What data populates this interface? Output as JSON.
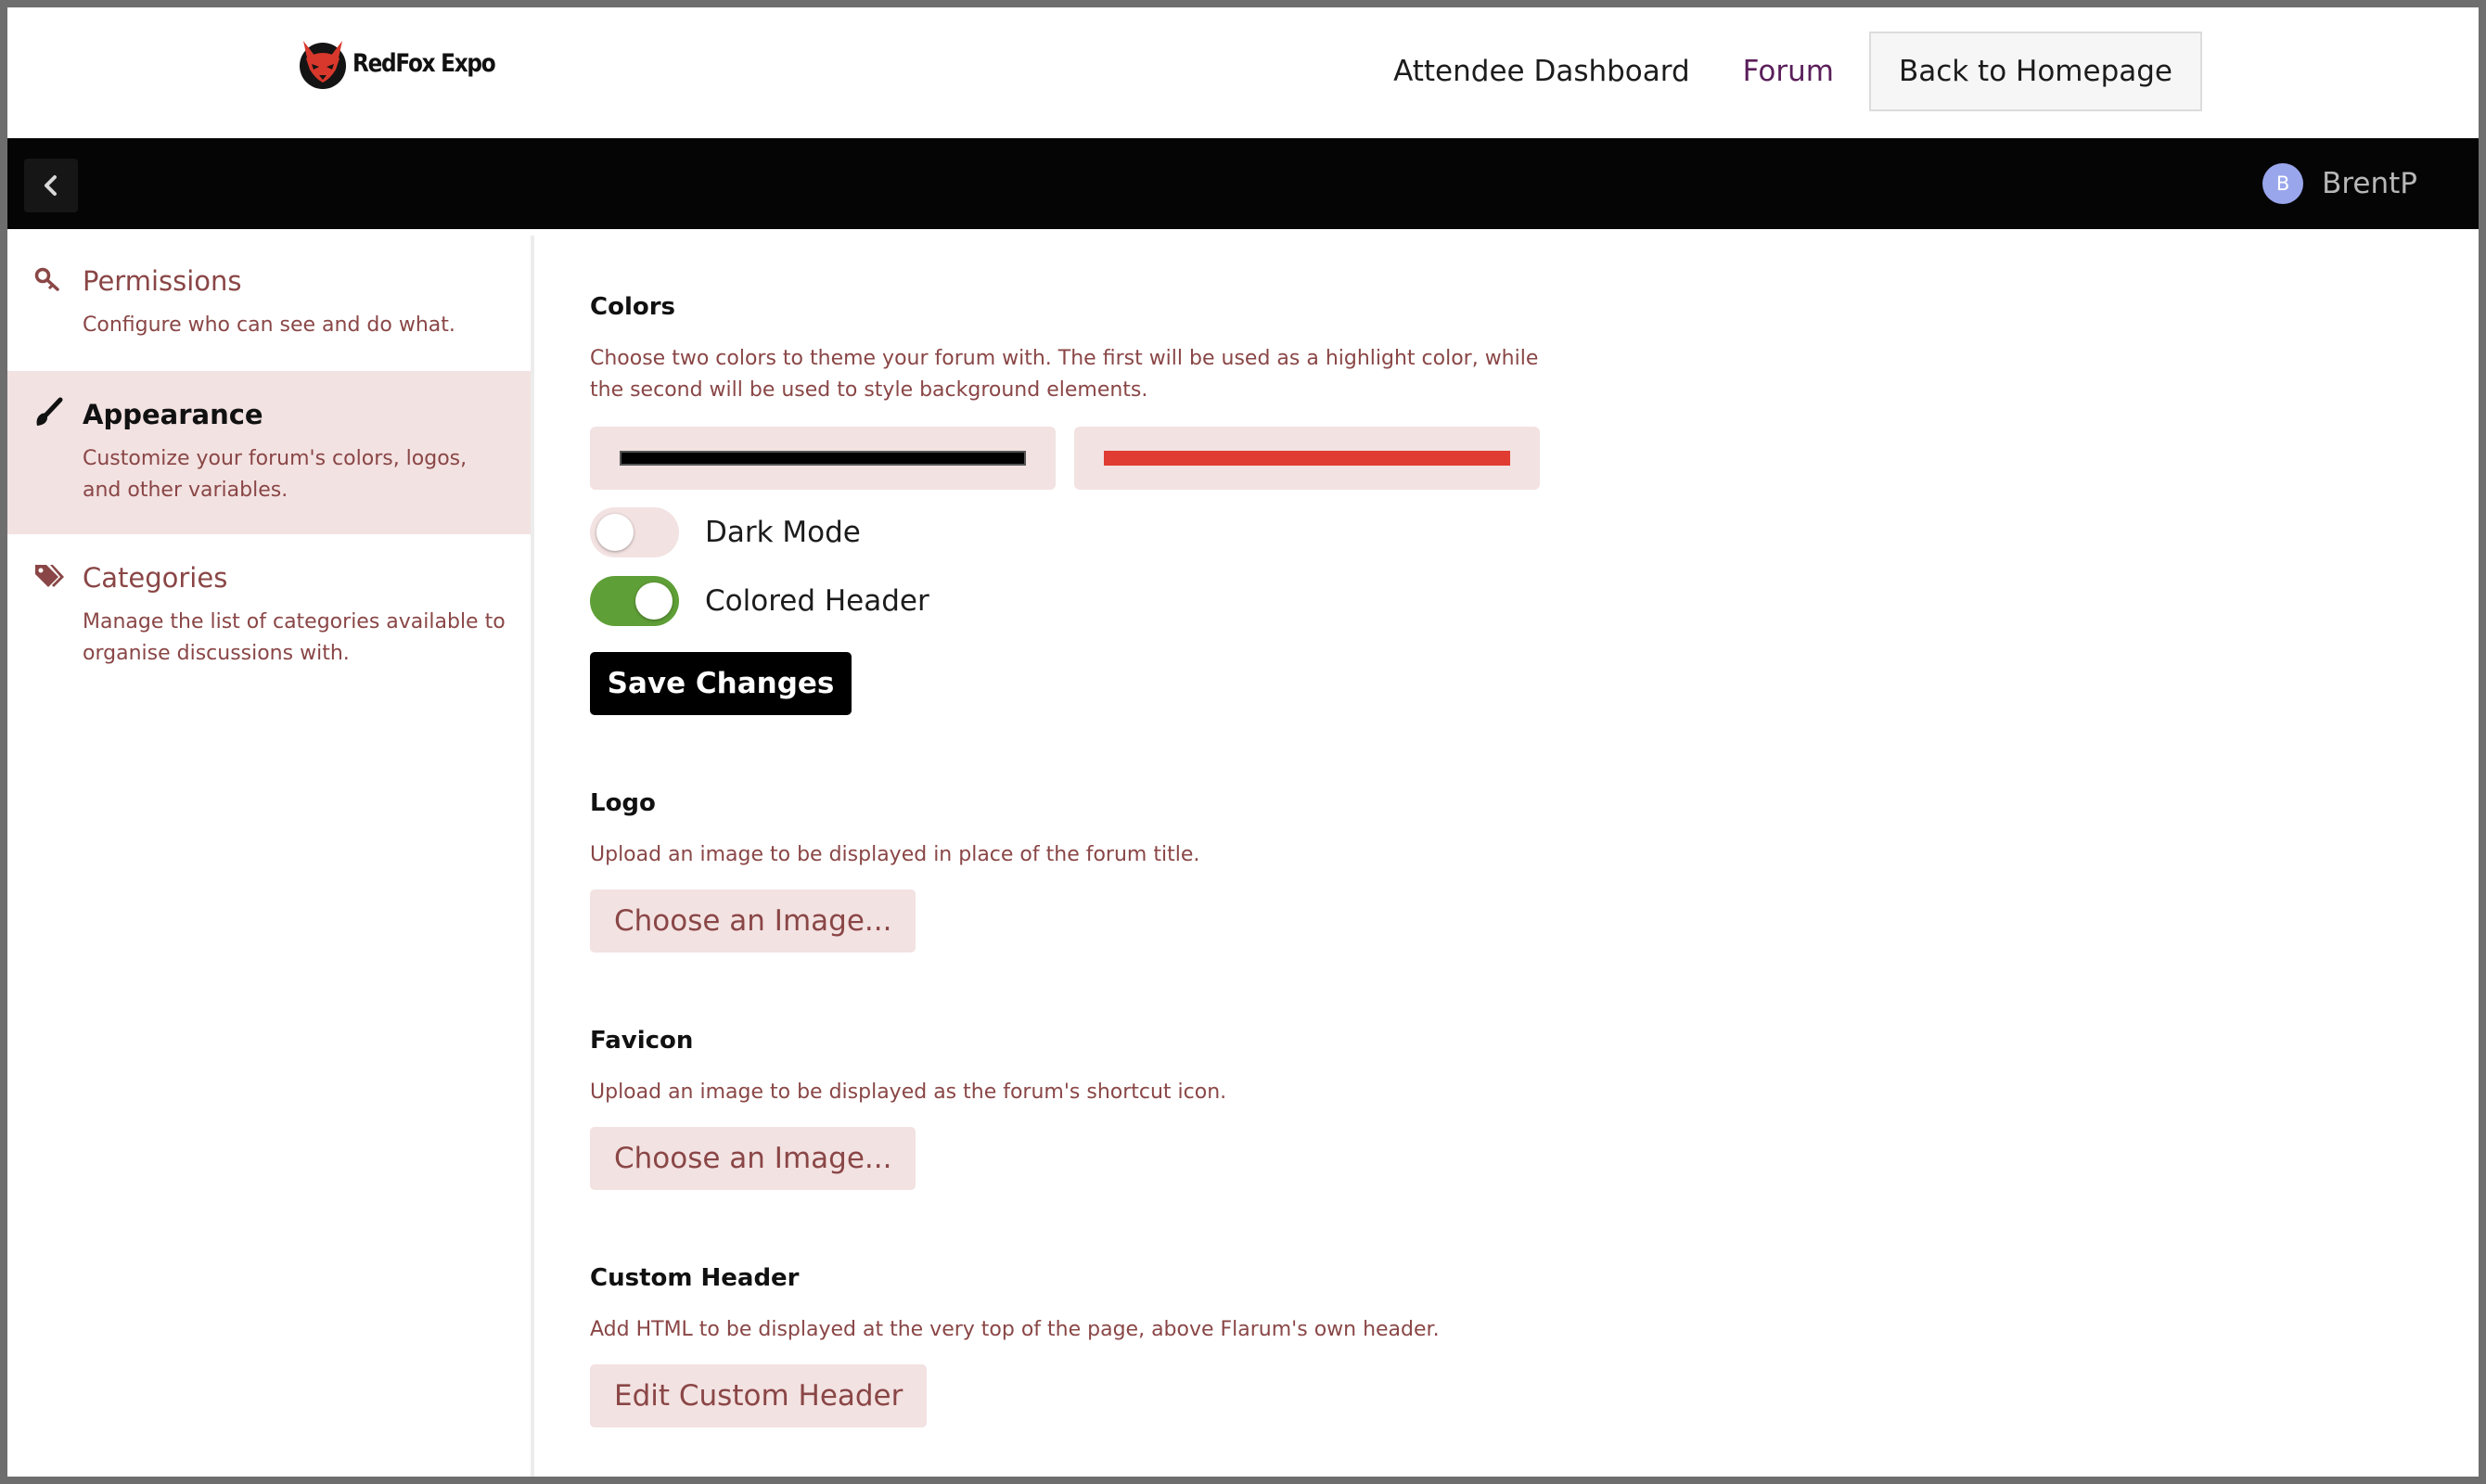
{
  "site": {
    "logo_text": "RedFox Expo",
    "nav": {
      "attendee_dashboard": "Attendee Dashboard",
      "forum": "Forum",
      "back_to_homepage": "Back to Homepage"
    }
  },
  "admin_header": {
    "back_icon": "chevron-left-icon",
    "user": {
      "avatar_letter": "B",
      "name": "BrentP",
      "avatar_color": "#9aa6ec"
    }
  },
  "sidebar": {
    "items": [
      {
        "icon": "key-icon",
        "title": "Permissions",
        "description": "Configure who can see and do what.",
        "active": false
      },
      {
        "icon": "paintbrush-icon",
        "title": "Appearance",
        "description": "Customize your forum's colors, logos, and other variables.",
        "active": true
      },
      {
        "icon": "tags-icon",
        "title": "Categories",
        "description": "Manage the list of categories available to organise discussions with.",
        "active": false
      }
    ]
  },
  "colors": {
    "title": "Colors",
    "description": "Choose two colors to theme your forum with. The first will be used as a highlight color, while the second will be used to style background elements.",
    "primary_color": "#000000",
    "secondary_color": "#e03c31",
    "dark_mode": {
      "label": "Dark Mode",
      "enabled": false
    },
    "colored_header": {
      "label": "Colored Header",
      "enabled": true
    },
    "save_label": "Save Changes"
  },
  "logo": {
    "title": "Logo",
    "description": "Upload an image to be displayed in place of the forum title.",
    "button": "Choose an Image..."
  },
  "favicon": {
    "title": "Favicon",
    "description": "Upload an image to be displayed as the forum's shortcut icon.",
    "button": "Choose an Image..."
  },
  "custom_header": {
    "title": "Custom Header",
    "description": "Add HTML to be displayed at the very top of the page, above Flarum's own header.",
    "button": "Edit Custom Header"
  },
  "theme": {
    "accent": "#000000",
    "secondary": "#e03c31",
    "toggle_on": "#5f9f37",
    "active_bg": "#f3e2e2",
    "muted_text": "#8a4646"
  }
}
